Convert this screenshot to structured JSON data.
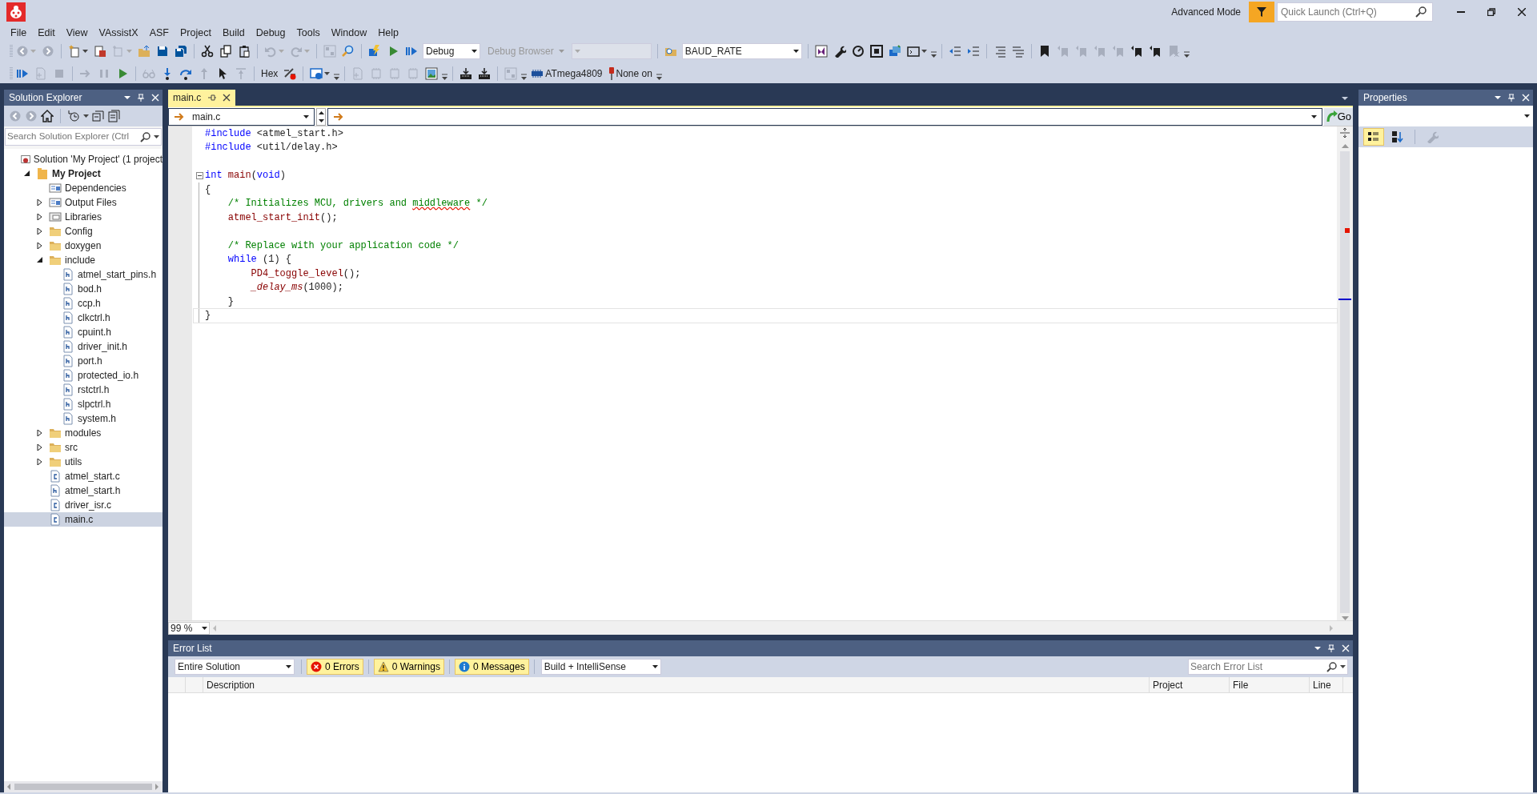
{
  "title_bar": {
    "mode_label": "Advanced Mode",
    "quick_launch": {
      "placeholder": "Quick Launch (Ctrl+Q)"
    }
  },
  "menu": [
    "File",
    "Edit",
    "View",
    "VAssistX",
    "ASF",
    "Project",
    "Build",
    "Debug",
    "Tools",
    "Window",
    "Help"
  ],
  "toolbar_1": [
    {
      "kind": "split",
      "disabled": true
    },
    {
      "kind": "button",
      "disabled": true
    },
    {
      "kind": "separator"
    },
    {
      "kind": "split",
      "disabled": false
    },
    {
      "kind": "button",
      "disabled": false
    },
    {
      "kind": "split",
      "disabled": true
    },
    {
      "kind": "button",
      "disabled": false
    },
    {
      "kind": "button",
      "disabled": false
    },
    {
      "kind": "button",
      "disabled": false
    },
    {
      "kind": "separator"
    },
    {
      "kind": "button",
      "disabled": false
    },
    {
      "kind": "button",
      "disabled": false
    },
    {
      "kind": "button",
      "disabled": false
    },
    {
      "kind": "separator"
    },
    {
      "kind": "split",
      "disabled": true
    },
    {
      "kind": "split",
      "disabled": true
    },
    {
      "kind": "separator"
    },
    {
      "kind": "button",
      "disabled": true
    },
    {
      "kind": "button",
      "disabled": false
    },
    {
      "kind": "separator"
    },
    {
      "kind": "button",
      "disabled": false
    },
    {
      "kind": "button",
      "disabled": false
    },
    {
      "kind": "button",
      "disabled": false
    },
    {
      "kind": "combo",
      "value": "Debug",
      "disabled": false
    },
    {
      "kind": "dropdown",
      "value": "Debug Browser",
      "disabled": true
    },
    {
      "kind": "combo",
      "disabled": true
    },
    {
      "kind": "separator"
    },
    {
      "kind": "button",
      "disabled": false
    },
    {
      "kind": "combo",
      "value": "BAUD_RATE",
      "disabled": false
    },
    {
      "kind": "separator"
    },
    {
      "kind": "button",
      "disabled": false
    },
    {
      "kind": "button",
      "disabled": false
    },
    {
      "kind": "button",
      "disabled": false
    },
    {
      "kind": "button",
      "disabled": false
    },
    {
      "kind": "button",
      "disabled": false
    },
    {
      "kind": "split",
      "disabled": false
    },
    {
      "kind": "overflow"
    },
    {
      "kind": "separator"
    },
    {
      "kind": "button",
      "disabled": false
    },
    {
      "kind": "button",
      "disabled": false
    },
    {
      "kind": "separator"
    },
    {
      "kind": "button",
      "disabled": false
    },
    {
      "kind": "button",
      "disabled": false
    },
    {
      "kind": "separator"
    },
    {
      "kind": "button",
      "disabled": false
    },
    {
      "kind": "button",
      "disabled": true
    },
    {
      "kind": "button",
      "disabled": true
    },
    {
      "kind": "button",
      "disabled": true
    },
    {
      "kind": "button",
      "disabled": true
    },
    {
      "kind": "button",
      "disabled": false
    },
    {
      "kind": "button",
      "disabled": false
    },
    {
      "kind": "button",
      "disabled": true
    },
    {
      "kind": "overflow"
    }
  ],
  "toolbar_2": [
    {
      "kind": "button",
      "disabled": false
    },
    {
      "kind": "button",
      "disabled": true
    },
    {
      "kind": "button",
      "disabled": true
    },
    {
      "kind": "separator"
    },
    {
      "kind": "button",
      "disabled": true
    },
    {
      "kind": "button",
      "disabled": true
    },
    {
      "kind": "button",
      "disabled": false
    },
    {
      "kind": "separator"
    },
    {
      "kind": "button",
      "disabled": true
    },
    {
      "kind": "button",
      "disabled": false
    },
    {
      "kind": "button",
      "disabled": false
    },
    {
      "kind": "button",
      "disabled": true
    },
    {
      "kind": "button",
      "disabled": false
    },
    {
      "kind": "button",
      "disabled": true
    },
    {
      "kind": "separator"
    },
    {
      "kind": "button",
      "label": "Hex",
      "disabled": false
    },
    {
      "kind": "button",
      "disabled": false
    },
    {
      "kind": "separator"
    },
    {
      "kind": "split",
      "disabled": false
    },
    {
      "kind": "overflow"
    },
    {
      "kind": "separator"
    },
    {
      "kind": "button",
      "disabled": true
    },
    {
      "kind": "button",
      "disabled": true
    },
    {
      "kind": "button",
      "disabled": true
    },
    {
      "kind": "button",
      "disabled": true
    },
    {
      "kind": "button",
      "disabled": false
    },
    {
      "kind": "overflow"
    },
    {
      "kind": "separator"
    },
    {
      "kind": "button",
      "disabled": false
    },
    {
      "kind": "button",
      "disabled": false
    },
    {
      "kind": "separator"
    },
    {
      "kind": "button",
      "disabled": true
    },
    {
      "kind": "overflow"
    },
    {
      "kind": "button",
      "label": "ATmega4809",
      "disabled": false
    },
    {
      "kind": "button",
      "label": "None on",
      "disabled": false
    },
    {
      "kind": "overflow"
    }
  ],
  "solution_explorer": {
    "title": "Solution Explorer",
    "search": {
      "placeholder": "Search Solution Explorer (Ctrl"
    },
    "tree": [
      {
        "kind": "solution",
        "label": "Solution 'My Project' (1 project",
        "selected": false,
        "children": [
          {
            "kind": "project",
            "label": "My Project",
            "expanded": true,
            "selected": false,
            "children": [
              {
                "kind": "references",
                "label": "Dependencies",
                "selected": false
              },
              {
                "kind": "references",
                "label": "Output Files",
                "expanded": false,
                "selected": false
              },
              {
                "kind": "library",
                "label": "Libraries",
                "expanded": false,
                "selected": false
              },
              {
                "kind": "folder",
                "label": "Config",
                "expanded": false,
                "selected": false
              },
              {
                "kind": "folder",
                "label": "doxygen",
                "expanded": false,
                "selected": false
              },
              {
                "kind": "folder",
                "label": "include",
                "expanded": true,
                "selected": false,
                "children": [
                  {
                    "kind": "header",
                    "label": "atmel_start_pins.h",
                    "selected": false
                  },
                  {
                    "kind": "header",
                    "label": "bod.h",
                    "selected": false
                  },
                  {
                    "kind": "header",
                    "label": "ccp.h",
                    "selected": false
                  },
                  {
                    "kind": "header",
                    "label": "clkctrl.h",
                    "selected": false
                  },
                  {
                    "kind": "header",
                    "label": "cpuint.h",
                    "selected": false
                  },
                  {
                    "kind": "header",
                    "label": "driver_init.h",
                    "selected": false
                  },
                  {
                    "kind": "header",
                    "label": "port.h",
                    "selected": false
                  },
                  {
                    "kind": "header",
                    "label": "protected_io.h",
                    "selected": false
                  },
                  {
                    "kind": "header",
                    "label": "rstctrl.h",
                    "selected": false
                  },
                  {
                    "kind": "header",
                    "label": "slpctrl.h",
                    "selected": false
                  },
                  {
                    "kind": "header",
                    "label": "system.h",
                    "selected": false
                  }
                ]
              },
              {
                "kind": "folder",
                "label": "modules",
                "expanded": false,
                "selected": false
              },
              {
                "kind": "folder",
                "label": "src",
                "expanded": false,
                "selected": false
              },
              {
                "kind": "folder",
                "label": "utils",
                "expanded": false,
                "selected": false
              },
              {
                "kind": "source",
                "label": "atmel_start.c",
                "selected": false
              },
              {
                "kind": "header",
                "label": "atmel_start.h",
                "selected": false
              },
              {
                "kind": "source",
                "label": "driver_isr.c",
                "selected": false
              },
              {
                "kind": "source",
                "label": "main.c",
                "selected": true
              }
            ]
          }
        ]
      }
    ]
  },
  "editor": {
    "tabs": [
      {
        "label": "main.c",
        "selected": true
      }
    ],
    "file_combo": "main.c",
    "go_label": "Go",
    "zoom": "99 %",
    "lines": [
      {
        "kind": "code",
        "current": false,
        "tokens": [
          {
            "kind": "keyword",
            "text": "#include"
          },
          {
            "kind": "plain",
            "text": " <atmel_start.h>"
          }
        ]
      },
      {
        "kind": "code",
        "current": false,
        "tokens": [
          {
            "kind": "keyword",
            "text": "#include"
          },
          {
            "kind": "plain",
            "text": " <util/delay.h>"
          }
        ]
      },
      {
        "kind": "blank",
        "current": false
      },
      {
        "kind": "fold_start",
        "current": false,
        "tokens": [
          {
            "kind": "keyword",
            "text": "int"
          },
          {
            "kind": "function",
            "text": " main"
          },
          {
            "kind": "plain",
            "text": "("
          },
          {
            "kind": "keyword",
            "text": "void"
          },
          {
            "kind": "plain",
            "text": ")"
          }
        ]
      },
      {
        "kind": "code",
        "current": false,
        "tokens": [
          {
            "kind": "plain",
            "text": "{"
          }
        ]
      },
      {
        "kind": "code",
        "current": false,
        "tokens": [
          {
            "kind": "comment",
            "text": "    /* Initializes MCU, drivers and "
          },
          {
            "kind": "misspelled",
            "text": "middleware"
          },
          {
            "kind": "comment",
            "text": " */"
          }
        ]
      },
      {
        "kind": "code",
        "current": false,
        "tokens": [
          {
            "kind": "function",
            "text": "    atmel_start_init"
          },
          {
            "kind": "plain",
            "text": "();"
          }
        ]
      },
      {
        "kind": "blank",
        "current": false
      },
      {
        "kind": "code",
        "current": false,
        "tokens": [
          {
            "kind": "comment",
            "text": "    /* Replace with your application code */"
          }
        ]
      },
      {
        "kind": "code",
        "current": false,
        "tokens": [
          {
            "kind": "keyword",
            "text": "    while"
          },
          {
            "kind": "plain",
            "text": " (1) {"
          }
        ]
      },
      {
        "kind": "code",
        "current": false,
        "tokens": [
          {
            "kind": "function",
            "text": "        PD4_toggle_level"
          },
          {
            "kind": "plain",
            "text": "();"
          }
        ]
      },
      {
        "kind": "code",
        "current": false,
        "tokens": [
          {
            "kind": "macro",
            "text": "        _delay_ms"
          },
          {
            "kind": "plain",
            "text": "(1000);"
          }
        ]
      },
      {
        "kind": "code",
        "current": false,
        "tokens": [
          {
            "kind": "plain",
            "text": "    }"
          }
        ]
      },
      {
        "kind": "code",
        "current": true,
        "tokens": [
          {
            "kind": "plain",
            "text": "}"
          }
        ]
      }
    ]
  },
  "error_list": {
    "title": "Error List",
    "scope": "Entire Solution",
    "filters": [
      {
        "kind": "error",
        "label": "0 Errors",
        "selected": true
      },
      {
        "kind": "warning",
        "label": "0 Warnings",
        "selected": true
      },
      {
        "kind": "message",
        "label": "0 Messages",
        "selected": true
      }
    ],
    "source": "Build + IntelliSense",
    "search": {
      "placeholder": "Search Error List"
    },
    "columns": [
      "Description",
      "Project",
      "File",
      "Line"
    ]
  },
  "properties": {
    "title": "Properties",
    "tools": [
      {
        "kind": "categorized",
        "selected": true
      },
      {
        "kind": "alphabetical",
        "selected": false
      },
      {
        "kind": "pages",
        "selected": false,
        "disabled": true
      }
    ]
  }
}
